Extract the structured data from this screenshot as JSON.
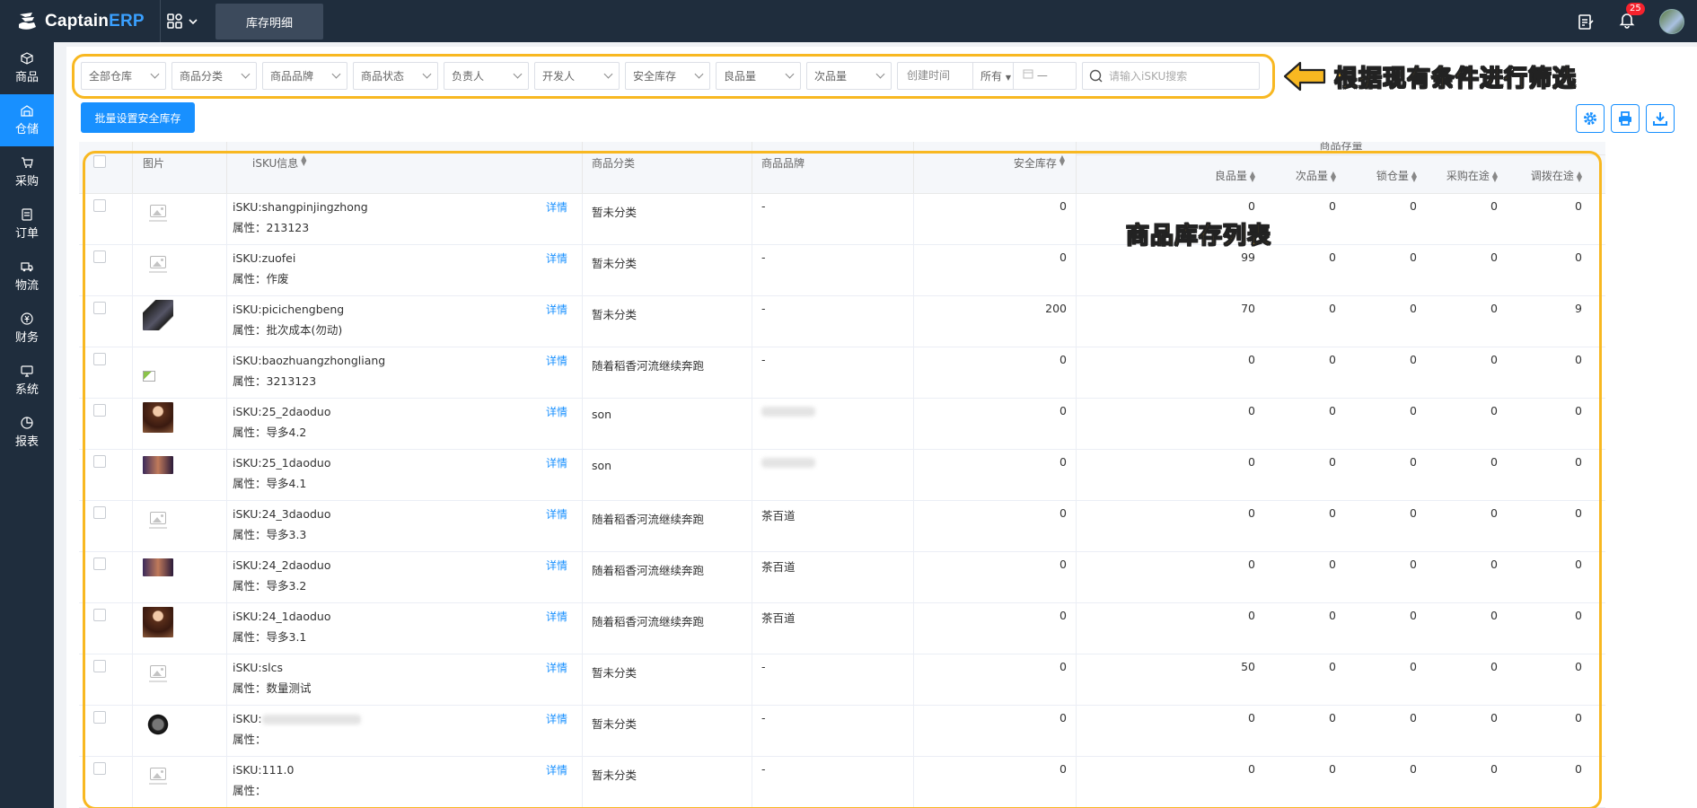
{
  "brand": {
    "name_main": "Captain",
    "name_accent": "ERP"
  },
  "top_tab": "库存明细",
  "notifications_count": "25",
  "sidebar": [
    {
      "label": "商品",
      "icon": "cube-icon"
    },
    {
      "label": "仓储",
      "icon": "warehouse-icon",
      "active": true
    },
    {
      "label": "采购",
      "icon": "cart-icon"
    },
    {
      "label": "订单",
      "icon": "order-icon"
    },
    {
      "label": "物流",
      "icon": "truck-icon"
    },
    {
      "label": "财务",
      "icon": "money-icon"
    },
    {
      "label": "系统",
      "icon": "system-icon"
    },
    {
      "label": "报表",
      "icon": "chart-icon"
    }
  ],
  "filters": [
    "全部仓库",
    "商品分类",
    "商品品牌",
    "商品状态",
    "负责人",
    "开发人",
    "安全库存",
    "良品量",
    "次品量"
  ],
  "date_filter": {
    "label": "创建时间",
    "range": "所有",
    "sep": "—"
  },
  "search_placeholder": "请输入iSKU搜索",
  "annotations": {
    "filter_note": "根据现有条件进行筛选",
    "list_note": "商品库存列表"
  },
  "batch_button": "批量设置安全库存",
  "columns": {
    "image": "图片",
    "sku": "iSKU信息",
    "category": "商品分类",
    "brand": "商品品牌",
    "safety": "安全库存",
    "group": "商品存量",
    "good": "良品量",
    "defect": "次品量",
    "locked": "锁仓量",
    "purchase": "采购在途",
    "transfer": "调拨在途"
  },
  "detail_label": "详情",
  "rows": [
    {
      "sku": "iSKU:shangpinjingzhong",
      "attr": "属性：213123",
      "category": "暂未分类",
      "brand": "-",
      "safety": "0",
      "good": "0",
      "defect": "0",
      "locked": "0",
      "purchase": "0",
      "transfer": "0",
      "img": "placeholder"
    },
    {
      "sku": "iSKU:zuofei",
      "attr": "属性：作废",
      "category": "暂未分类",
      "brand": "-",
      "safety": "0",
      "good": "99",
      "defect": "0",
      "locked": "0",
      "purchase": "0",
      "transfer": "0",
      "img": "placeholder"
    },
    {
      "sku": "iSKU:picichengbeng",
      "attr": "属性：批次成本(勿动)",
      "category": "暂未分类",
      "brand": "-",
      "safety": "200",
      "good": "70",
      "defect": "0",
      "locked": "0",
      "purchase": "0",
      "transfer": "9",
      "img": "phone"
    },
    {
      "sku": "iSKU:baozhuangzhongliang",
      "attr": "属性：3213123",
      "category": "随着稻香河流继续奔跑",
      "brand": "-",
      "safety": "0",
      "good": "0",
      "defect": "0",
      "locked": "0",
      "purchase": "0",
      "transfer": "0",
      "img": "broken"
    },
    {
      "sku": "iSKU:25_2daoduo",
      "attr": "属性：导多4.2",
      "category": "son",
      "brand": "",
      "safety": "0",
      "good": "0",
      "defect": "0",
      "locked": "0",
      "purchase": "0",
      "transfer": "0",
      "img": "portrait"
    },
    {
      "sku": "iSKU:25_1daoduo",
      "attr": "属性：导多4.1",
      "category": "son",
      "brand": "",
      "safety": "0",
      "good": "0",
      "defect": "0",
      "locked": "0",
      "purchase": "0",
      "transfer": "0",
      "img": "banner"
    },
    {
      "sku": "iSKU:24_3daoduo",
      "attr": "属性：导多3.3",
      "category": "随着稻香河流继续奔跑",
      "brand": "茶百道",
      "safety": "0",
      "good": "0",
      "defect": "0",
      "locked": "0",
      "purchase": "0",
      "transfer": "0",
      "img": "placeholder"
    },
    {
      "sku": "iSKU:24_2daoduo",
      "attr": "属性：导多3.2",
      "category": "随着稻香河流继续奔跑",
      "brand": "茶百道",
      "safety": "0",
      "good": "0",
      "defect": "0",
      "locked": "0",
      "purchase": "0",
      "transfer": "0",
      "img": "banner"
    },
    {
      "sku": "iSKU:24_1daoduo",
      "attr": "属性：导多3.1",
      "category": "随着稻香河流继续奔跑",
      "brand": "茶百道",
      "safety": "0",
      "good": "0",
      "defect": "0",
      "locked": "0",
      "purchase": "0",
      "transfer": "0",
      "img": "portrait"
    },
    {
      "sku": "iSKU:slcs",
      "attr": "属性：数量测试",
      "category": "暂未分类",
      "brand": "-",
      "safety": "0",
      "good": "50",
      "defect": "0",
      "locked": "0",
      "purchase": "0",
      "transfer": "0",
      "img": "placeholder"
    },
    {
      "sku": "iSKU:",
      "attr": "属性：",
      "category": "暂未分类",
      "brand": "-",
      "safety": "0",
      "good": "0",
      "defect": "0",
      "locked": "0",
      "purchase": "0",
      "transfer": "0",
      "img": "watch",
      "sku_blurred": true
    },
    {
      "sku": "iSKU:111.0",
      "attr": "属性：",
      "category": "暂未分类",
      "brand": "-",
      "safety": "0",
      "good": "0",
      "defect": "0",
      "locked": "0",
      "purchase": "0",
      "transfer": "0",
      "img": "placeholder"
    }
  ]
}
